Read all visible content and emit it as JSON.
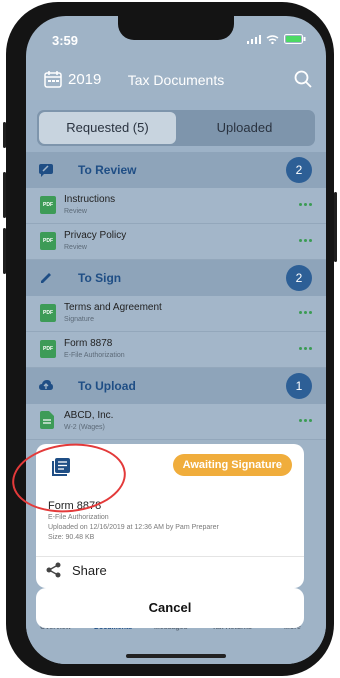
{
  "status": {
    "time": "3:59"
  },
  "nav": {
    "year": "2019",
    "title": "Tax Documents"
  },
  "segments": {
    "requested": "Requested (5)",
    "uploaded": "Uploaded"
  },
  "sections": [
    {
      "title": "To Review",
      "count": "2",
      "items": [
        {
          "title": "Instructions",
          "subtitle": "Review"
        },
        {
          "title": "Privacy Policy",
          "subtitle": "Review"
        }
      ]
    },
    {
      "title": "To Sign",
      "count": "2",
      "items": [
        {
          "title": "Terms and Agreement",
          "subtitle": "Signature"
        },
        {
          "title": "Form 8878",
          "subtitle": "E-File Authorization"
        }
      ]
    },
    {
      "title": "To Upload",
      "count": "1",
      "items": [
        {
          "title": "ABCD, Inc.",
          "subtitle": "W-2 (Wages)"
        }
      ]
    }
  ],
  "sheet": {
    "badge": "Awaiting Signature",
    "title": "Form 8878",
    "subtitle": "E-File Authorization",
    "uploaded": "Uploaded on 12/16/2019 at 12:36 AM by Pam Preparer",
    "size": "Size: 90.48 KB",
    "share": "Share",
    "cancel": "Cancel"
  },
  "tabs": [
    "Overview",
    "Documents",
    "Messages",
    "Tax Returns",
    "More"
  ],
  "colors": {
    "accent": "#1f4e85",
    "pending": "#f0ad3c",
    "doc_green": "#3d9b57",
    "highlight": "#e33a3a"
  }
}
